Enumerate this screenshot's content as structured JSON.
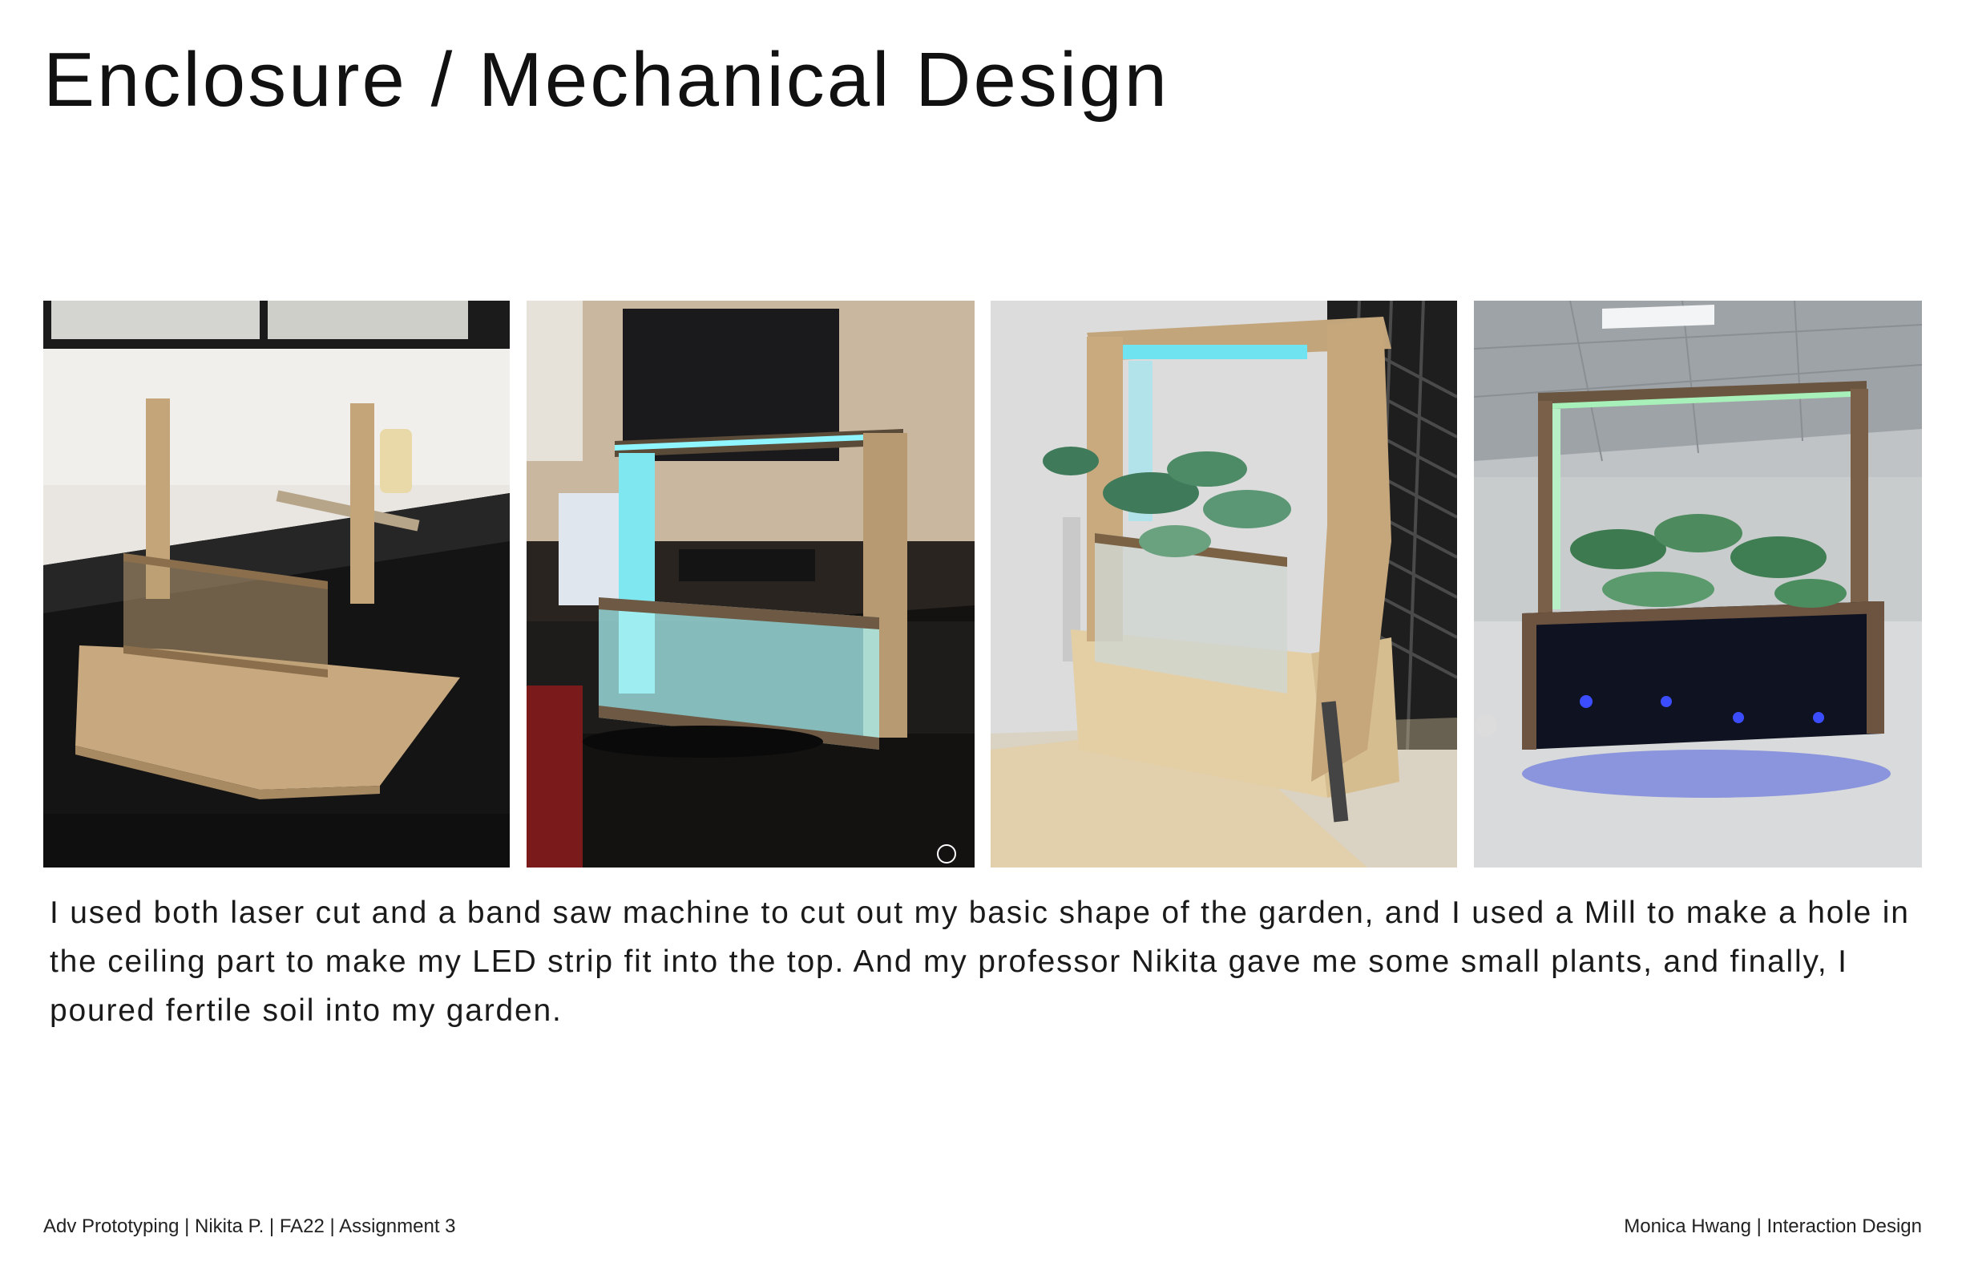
{
  "title": "Enclosure / Mechanical Design",
  "photos": [
    {
      "name": "mdf-frame-prototype"
    },
    {
      "name": "led-frame-on-desk"
    },
    {
      "name": "wooden-planter-with-plants"
    },
    {
      "name": "final-garden-with-leds"
    }
  ],
  "body": "I used both laser cut and a band saw machine to cut out my basic shape of the garden, and I used a Mill to make a hole in the ceiling part to make my LED strip fit into the top. And my professor Nikita gave me some small plants, and finally, I poured fertile soil into my garden.",
  "footer": {
    "left": "Adv Prototyping | Nikita P. | FA22 | Assignment 3",
    "right": "Monica Hwang |  Interaction Design"
  },
  "colors": {
    "mdf": "#c9a87c",
    "led_cyan": "#59e0e6",
    "led_blue": "#2a3cff",
    "led_green": "#8fe8a6"
  }
}
